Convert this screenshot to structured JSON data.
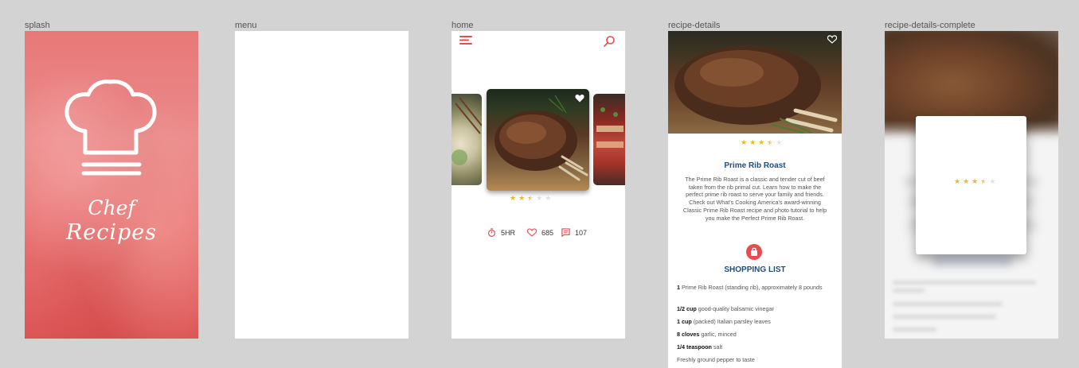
{
  "frames": {
    "splash": "splash",
    "menu": "menu",
    "home": "home",
    "details": "recipe-details",
    "complete": "recipe-details-complete"
  },
  "splash": {
    "title_line1": "Chef",
    "title_line2": "Recipes"
  },
  "home": {
    "rating": 2.5,
    "stats": {
      "time": "5HR",
      "likes": "685",
      "comments": "107"
    }
  },
  "details": {
    "rating": 3.5,
    "title": "Prime Rib Roast",
    "description": "The Prime Rib Roast is a classic and tender cut of beef taken from the rib primal cut.  Learn how to make the perfect prime rib roast to serve your family and friends.  Check out What's Cooking America's award-winning Classic Prime Rib Roast recipe and photo tutorial to help you make the Perfect Prime Rib Roast.",
    "shopping_title": "SHOPPING LIST",
    "ingredients": [
      {
        "qty": "1",
        "text": " Prime Rib Roast (standing rib), approximately 8 pounds"
      },
      {
        "qty": "1/2 cup",
        "text": " good-quality balsamic vinegar"
      },
      {
        "qty": "1 cup",
        "text": " (packed) Italian parsley leaves"
      },
      {
        "qty": "8 cloves",
        "text": " garlic, minced"
      },
      {
        "qty": "1/4 teaspoon",
        "text": " salt"
      },
      {
        "qty": "",
        "text": "Freshly ground pepper to taste"
      }
    ]
  },
  "complete": {
    "rating": 3.5
  },
  "colors": {
    "accent": "#e74c4c",
    "title_blue": "#1f4e7a",
    "star": "#f2b624"
  },
  "icons": [
    "chef-hat-icon",
    "hamburger-menu-icon",
    "search-icon",
    "heart-icon",
    "timer-icon",
    "comment-icon",
    "shopping-bag-icon"
  ]
}
